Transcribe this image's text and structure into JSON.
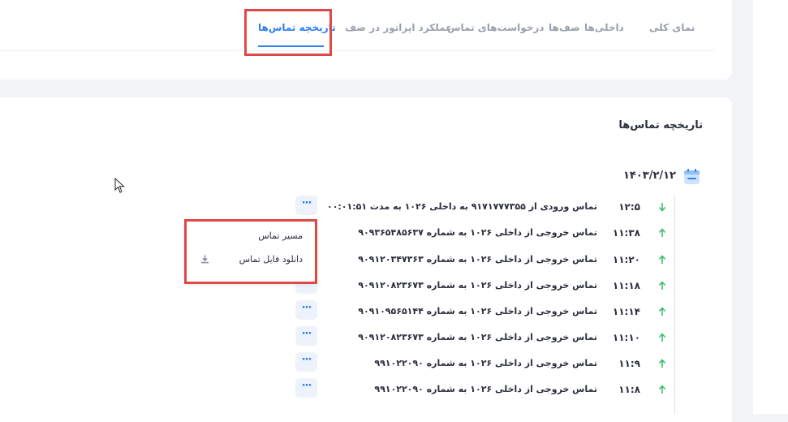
{
  "tabs": [
    {
      "label": "نمای کلی"
    },
    {
      "label": "داخلی‌ها"
    },
    {
      "label": "صف‌ها"
    },
    {
      "label": "درخواست‌های تماس"
    },
    {
      "label": "عملکرد اپراتور در صف"
    },
    {
      "label": "تاریخچه تماس‌ها"
    }
  ],
  "active_tab_index": 5,
  "history": {
    "title": "تاریخچه تماس‌ها",
    "date": "۱۴۰۳/۲/۱۲",
    "calls": [
      {
        "time": "۱۲:۵",
        "direction": "incoming",
        "description": "تماس ورودی از ۹۱۷۱۷۷۷۳۵۵ به داخلی ۱۰۲۶ به مدت ۰۰:۰۱:۵۱"
      },
      {
        "time": "۱۱:۳۸",
        "direction": "outgoing",
        "description": "تماس خروجی از داخلی ۱۰۲۶ به شماره ۹۰۹۳۶۵۴۸۵۶۳۷"
      },
      {
        "time": "۱۱:۲۰",
        "direction": "outgoing",
        "description": "تماس خروجی از داخلی ۱۰۲۶ به شماره ۹۰۹۱۲۰۳۴۷۳۶۳"
      },
      {
        "time": "۱۱:۱۸",
        "direction": "outgoing",
        "description": "تماس خروجی از داخلی ۱۰۲۶ به شماره ۹۰۹۱۲۰۸۲۳۶۷۳"
      },
      {
        "time": "۱۱:۱۴",
        "direction": "outgoing",
        "description": "تماس خروجی از داخلی ۱۰۲۶ به شماره ۹۰۹۱۰۹۵۶۵۱۴۴"
      },
      {
        "time": "۱۱:۱۰",
        "direction": "outgoing",
        "description": "تماس خروجی از داخلی ۱۰۲۶ به شماره ۹۰۹۱۲۰۸۲۳۶۷۳"
      },
      {
        "time": "۱۱:۹",
        "direction": "outgoing",
        "description": "تماس خروجی از داخلی ۱۰۲۶ به شماره ۹۹۱۰۲۲۰۹۰"
      },
      {
        "time": "۱۱:۸",
        "direction": "outgoing",
        "description": "تماس خروجی از داخلی ۱۰۲۶ به شماره ۹۹۱۰۲۲۰۹۰"
      }
    ],
    "more_label": "···"
  },
  "dropdown": {
    "items": [
      {
        "label": "مسیر تماس",
        "icon": "none"
      },
      {
        "label": "دانلود فایل تماس",
        "icon": "download-icon"
      }
    ]
  },
  "colors": {
    "accent": "#2d7ff0",
    "incoming_arrow": "#3cbf6e",
    "outgoing_arrow": "#3cbf6e",
    "highlight": "#e04848"
  }
}
